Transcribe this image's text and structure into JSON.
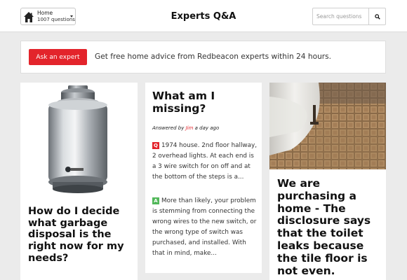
{
  "header": {
    "category_name": "Home",
    "category_count": "1007 questions",
    "title": "Experts Q&A",
    "search_placeholder": "Search questions"
  },
  "banner": {
    "button_label": "Ask an expert",
    "text": "Get free home advice from Redbeacon experts within 24 hours."
  },
  "cards": [
    {
      "image": "garbage-disposal-photo",
      "question": "How do I decide what garbage disposal is the right now for my needs?"
    },
    {
      "question": "What am I missing?",
      "answered_prefix": "Answered by",
      "answerer": "Jim",
      "answered_time": "a day ago",
      "q_badge": "Q",
      "q_text": "1974 house. 2nd floor hallway, 2 overhead lights. At each end is a 3 wire switch for on off and at the bottom of the steps is a...",
      "a_badge": "A",
      "a_text": "More than likely, your problem is stemming from connecting the wrong wires to the new switch, or the wrong type of switch was purchased, and installed. With that in mind, make..."
    },
    {
      "image": "toilet-tile-floor-photo",
      "question": "We are purchasing a home - The disclosure says that the toilet leaks because the tile floor is not even."
    }
  ],
  "colors": {
    "accent_red": "#e3242b",
    "answer_green": "#52b85a",
    "page_bg": "#ebebeb"
  }
}
